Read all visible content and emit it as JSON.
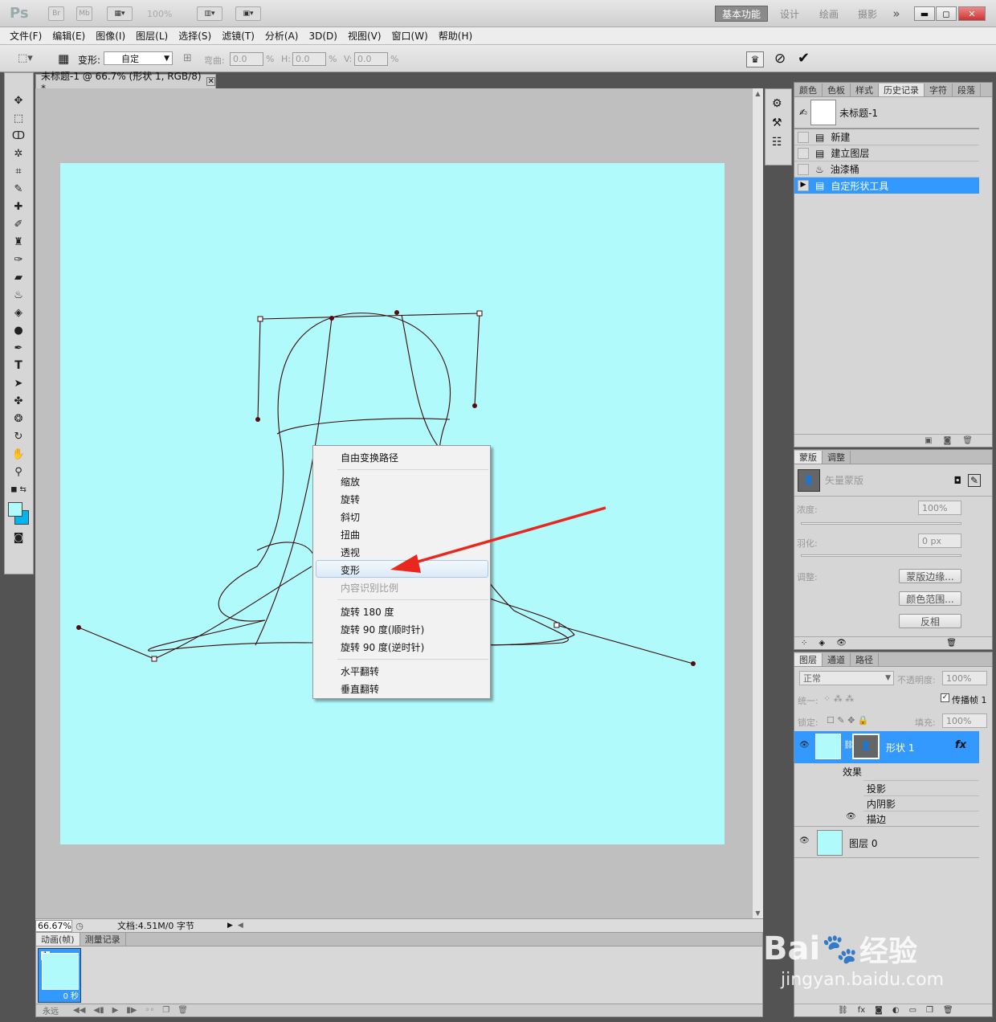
{
  "app": {
    "logo": "Ps",
    "br": "Br",
    "mb": "Mb",
    "zoom": "100%"
  },
  "workspaces": [
    "基本功能",
    "设计",
    "绘画",
    "摄影"
  ],
  "workspace_more": "»",
  "window_controls": {
    "minimize": "▬",
    "maximize": "◻",
    "close": "✕"
  },
  "menus": [
    "文件(F)",
    "编辑(E)",
    "图像(I)",
    "图层(L)",
    "选择(S)",
    "滤镜(T)",
    "分析(A)",
    "3D(D)",
    "视图(V)",
    "窗口(W)",
    "帮助(H)"
  ],
  "options": {
    "warp_label": "变形:",
    "warp_value": "自定",
    "bend_label": "弯曲:",
    "bend_value": "0.0",
    "h_label": "H:",
    "h_value": "0.0",
    "v_label": "V:",
    "v_value": "0.0",
    "pct": "%"
  },
  "document": {
    "tab_title": "未标题-1 @ 66.7% (形状 1, RGB/8) *",
    "zoom": "66.67%",
    "doc_info": "文档:4.51M/0 字节"
  },
  "context_menu": {
    "items": [
      {
        "label": "自由变换路径",
        "disabled": false
      },
      {
        "label": "缩放",
        "disabled": false
      },
      {
        "label": "旋转",
        "disabled": false
      },
      {
        "label": "斜切",
        "disabled": false
      },
      {
        "label": "扭曲",
        "disabled": false
      },
      {
        "label": "透视",
        "disabled": false
      },
      {
        "label": "变形",
        "disabled": false,
        "highlighted": true
      },
      {
        "label": "内容识别比例",
        "disabled": true
      },
      {
        "label": "旋转 180 度",
        "disabled": false
      },
      {
        "label": "旋转 90 度(顺时针)",
        "disabled": false
      },
      {
        "label": "旋转 90 度(逆时针)",
        "disabled": false
      },
      {
        "label": "水平翻转",
        "disabled": false
      },
      {
        "label": "垂直翻转",
        "disabled": false
      }
    ]
  },
  "history_panel": {
    "tabs": [
      "颜色",
      "色板",
      "样式",
      "历史记录",
      "字符",
      "段落"
    ],
    "active_tab": "历史记录",
    "snapshot": "未标题-1",
    "items": [
      "新建",
      "建立图层",
      "油漆桶",
      "自定形状工具"
    ],
    "selected": "自定形状工具"
  },
  "mask_panel": {
    "tabs": [
      "蒙版",
      "调整"
    ],
    "title": "矢量蒙版",
    "density_label": "浓度:",
    "density_value": "100%",
    "feather_label": "羽化:",
    "feather_value": "0 px",
    "adjust_label": "调整:",
    "buttons": [
      "蒙版边缘...",
      "颜色范围...",
      "反相"
    ]
  },
  "layers_panel": {
    "tabs": [
      "图层",
      "通道",
      "路径"
    ],
    "blend_mode": "正常",
    "opacity_label": "不透明度:",
    "opacity_value": "100%",
    "unify_label": "统一:",
    "propagate_label": "传播帧 1",
    "lock_label": "锁定:",
    "fill_label": "填充:",
    "fill_value": "100%",
    "layers": [
      {
        "name": "形状 1",
        "selected": true
      },
      {
        "name": "图层 0",
        "selected": false
      }
    ],
    "effects_label": "效果",
    "effects": [
      "投影",
      "内阴影",
      "描边"
    ]
  },
  "animation_panel": {
    "tabs": [
      "动画(帧)",
      "测量记录"
    ],
    "frame_number": "1",
    "frame_delay": "0 秒",
    "loop": "永远"
  },
  "watermark": {
    "brand": "Bai",
    "brand2": "经验",
    "url": "jingyan.baidu.com"
  },
  "colors": {
    "canvas": "#b0fafc",
    "arrow": "#e8281e",
    "path": "#3a0808",
    "selection": "#3399ff"
  }
}
